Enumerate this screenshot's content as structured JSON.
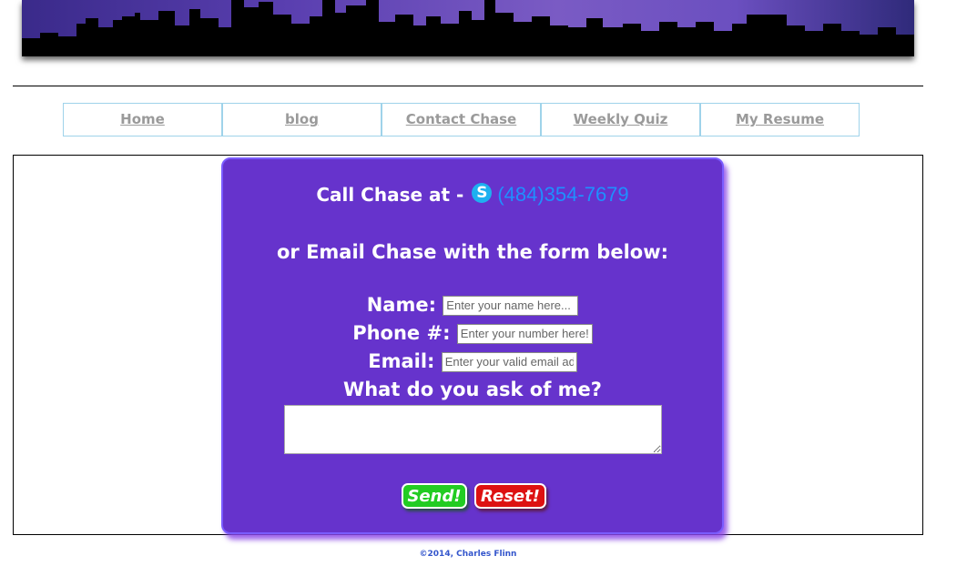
{
  "nav": {
    "items": [
      {
        "label": "Home"
      },
      {
        "label": "blog"
      },
      {
        "label": "Contact Chase"
      },
      {
        "label": "Weekly Quiz"
      },
      {
        "label": "My Resume"
      }
    ]
  },
  "contact": {
    "call_prefix": "Call Chase at -",
    "skype_icon": "skype-icon",
    "skype_letter": "S",
    "phone": "(484)354-7679",
    "email_intro": "or Email Chase with the form below:",
    "name_label": "Name:",
    "name_placeholder": "Enter your name here...",
    "phone_label": "Phone #:",
    "phone_placeholder": "Enter your number here!",
    "email_label": "Email:",
    "email_placeholder": "Enter your valid email address",
    "ask_label": "What do you ask of me?",
    "send_label": "Send!",
    "reset_label": "Reset!"
  },
  "colors": {
    "panel": "#6633cc",
    "send": "#22cc22",
    "reset": "#dd1111",
    "phone_link": "#1e90ff"
  },
  "footer": {
    "copyright": "©2014, Charles Flinn"
  }
}
